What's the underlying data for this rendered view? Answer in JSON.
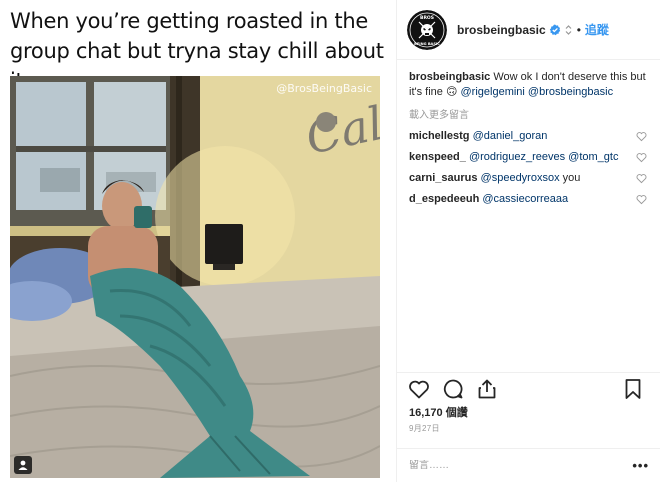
{
  "meme": {
    "caption_line1": "When you’re getting roasted in the",
    "caption_line2": "group chat but tryna stay chill about it",
    "watermark": "@BrosBeingBasic"
  },
  "header": {
    "username": "brosbeingbasic",
    "dot": "•",
    "follow_label": "追蹤",
    "avatar_text_top": "BROS",
    "avatar_text_bottom": "BEING BASIC"
  },
  "caption": {
    "username": "brosbeingbasic",
    "text": "Wow ok I don't deserve this but it's fine",
    "emoji": "🙃",
    "mention1": "@rigelgemini",
    "mention2": "@brosbeingbasic"
  },
  "load_more": "載入更多留言",
  "comments": [
    {
      "user": "michellestg",
      "mention": "@daniel_goran",
      "text": ""
    },
    {
      "user": "kenspeed_",
      "mention": "@rodriguez_reeves @tom_gtc",
      "text": ""
    },
    {
      "user": "carni_saurus",
      "mention": "@speedyroxsox",
      "text": " you"
    },
    {
      "user": "d_espedeeuh",
      "mention": "@cassiecorreaaa",
      "text": ""
    }
  ],
  "likes": "16,170 個讚",
  "date": "9月27日",
  "add_comment": {
    "placeholder": "留言……"
  },
  "more_options": "•••",
  "icons": [
    "heart-icon",
    "comment-icon",
    "share-icon",
    "bookmark-icon",
    "verified-icon",
    "more-options-icon",
    "user-tag-icon"
  ],
  "colors": {
    "accent": "#3897f0",
    "mention": "#003569",
    "muted": "#999999"
  }
}
